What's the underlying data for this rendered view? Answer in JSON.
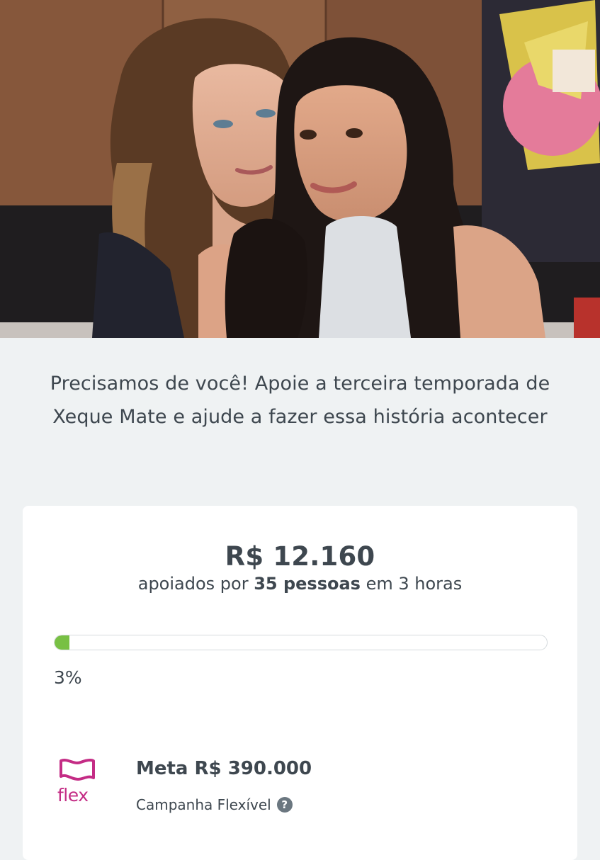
{
  "hero": {
    "image": "campaign-photo-two-women"
  },
  "tagline": {
    "line1": "Precisamos de você! Apoie a terceira temporada de",
    "line2": "Xeque Mate e ajude a fazer essa história acontecer"
  },
  "stats": {
    "amount": "R$ 12.160",
    "backers_prefix": "apoiados por",
    "backers_count": "35 pessoas",
    "backers_suffix": "em 3 horas",
    "progress_fraction": 0.03,
    "percent_label": "3%"
  },
  "goal": {
    "logo_text": "flex",
    "goal_label": "Meta R$ 390.000",
    "campaign_type": "Campanha Flexível",
    "help_icon": "question-circle-icon",
    "help_glyph": "?"
  },
  "colors": {
    "background": "#eff2f3",
    "text": "#3e474f",
    "progress": "#78c044",
    "flex_brand": "#c42c85"
  }
}
